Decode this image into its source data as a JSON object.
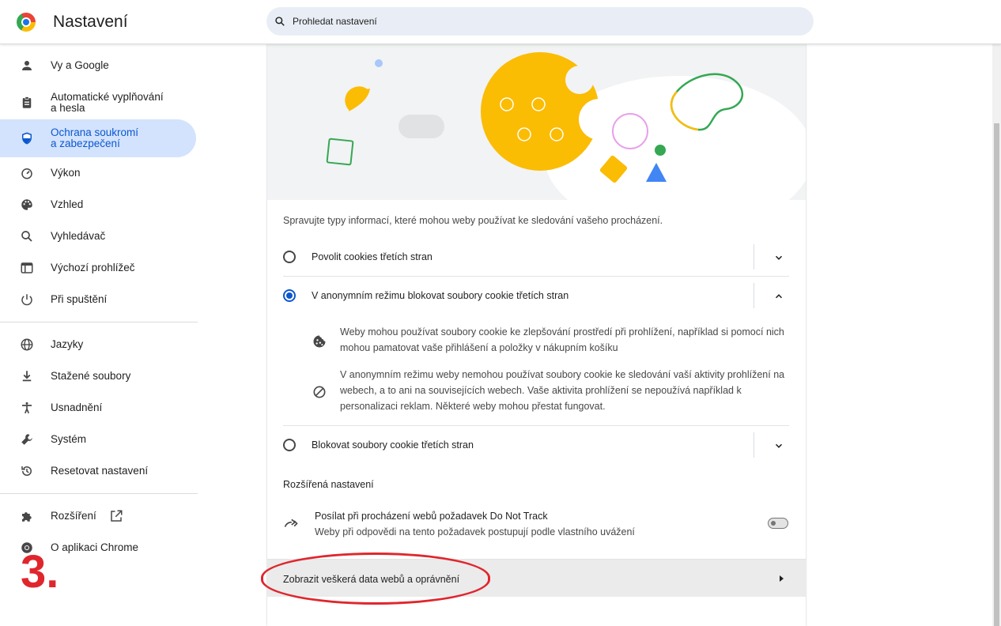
{
  "header": {
    "title": "Nastavení",
    "search_placeholder": "Prohledat nastavení"
  },
  "sidebar": {
    "items": [
      {
        "label": "Vy a Google",
        "icon": "person-icon"
      },
      {
        "label": "Automatické vyplňování\na hesla",
        "icon": "clipboard-icon"
      },
      {
        "label": "Ochrana soukromí\na zabezpečení",
        "icon": "shield-icon",
        "active": true
      },
      {
        "label": "Výkon",
        "icon": "gauge-icon"
      },
      {
        "label": "Vzhled",
        "icon": "palette-icon"
      },
      {
        "label": "Vyhledávač",
        "icon": "search-icon"
      },
      {
        "label": "Výchozí prohlížeč",
        "icon": "browser-icon"
      },
      {
        "label": "Při spuštění",
        "icon": "power-icon"
      },
      {
        "label": "Jazyky",
        "icon": "globe-icon"
      },
      {
        "label": "Stažené soubory",
        "icon": "download-icon"
      },
      {
        "label": "Usnadnění",
        "icon": "accessibility-icon"
      },
      {
        "label": "Systém",
        "icon": "wrench-icon"
      },
      {
        "label": "Resetovat nastavení",
        "icon": "history-icon"
      },
      {
        "label": "Rozšíření",
        "icon": "puzzle-icon"
      },
      {
        "label": "O aplikaci Chrome",
        "icon": "chrome-icon"
      }
    ]
  },
  "content": {
    "description": "Spravujte typy informací, které mohou weby používat ke sledování vašeho procházení.",
    "options": [
      {
        "label": "Povolit cookies třetích stran",
        "selected": false,
        "expanded": false
      },
      {
        "label": "V anonymním režimu blokovat soubory cookie třetích stran",
        "selected": true,
        "expanded": true
      },
      {
        "label": "Blokovat soubory cookie třetích stran",
        "selected": false,
        "expanded": false
      }
    ],
    "details": [
      {
        "text": "Weby mohou používat soubory cookie ke zlepšování prostředí při prohlížení, například si pomocí nich mohou pamatovat vaše přihlášení a položky v nákupním košíku",
        "icon": "cookie-icon"
      },
      {
        "text": "V anonymním režimu weby nemohou používat soubory cookie ke sledování vaší aktivity prohlížení na webech, a to ani na souvisejících webech. Vaše aktivita prohlížení se nepoužívá například k personalizaci reklam. Některé weby mohou přestat fungovat.",
        "icon": "block-icon"
      }
    ],
    "advanced_title": "Rozšířená nastavení",
    "dnt": {
      "title": "Posílat při procházení webů požadavek Do Not Track",
      "subtitle": "Weby při odpovědi na tento požadavek postupují podle vlastního uvážení",
      "enabled": false
    },
    "site_data_label": "Zobrazit veškerá data webů a oprávnění"
  },
  "annotation": {
    "step": "3."
  },
  "colors": {
    "accent": "#0b57d0",
    "active_bg": "#d3e3fd",
    "annotation_red": "#e0262d",
    "cookie_yellow": "#fbbc04"
  }
}
